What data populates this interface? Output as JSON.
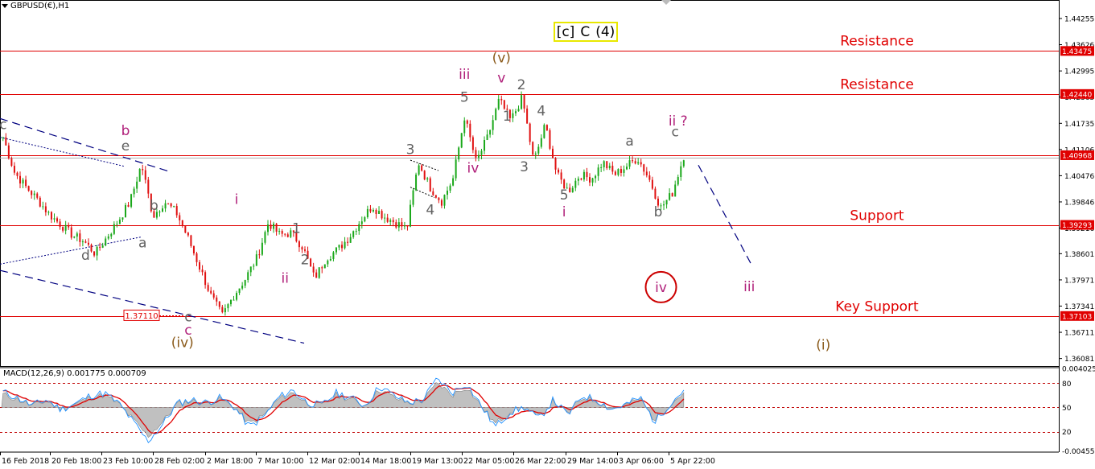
{
  "window": {
    "symbol_title": "GBPUSD(€),H1"
  },
  "indicator": {
    "label": "MACD(12,26,9) 0.001775 0.000709"
  },
  "banner": [
    {
      "text": "[c]",
      "color": "#1a8f3a"
    },
    {
      "text": "C",
      "color": "#e00000"
    },
    {
      "text": "(4)",
      "color": "#0000cc"
    }
  ],
  "price_axis": {
    "ticks": [
      "1.44255",
      "1.43626",
      "1.42995",
      "1.42365",
      "1.41735",
      "1.41106",
      "1.40476",
      "1.39846",
      "1.39216",
      "1.38601",
      "1.37971",
      "1.37341",
      "1.36711",
      "1.36081"
    ],
    "tick_values": [
      1.44255,
      1.43626,
      1.42995,
      1.42365,
      1.41735,
      1.41106,
      1.40476,
      1.39846,
      1.39216,
      1.38601,
      1.37971,
      1.37341,
      1.36711,
      1.36081
    ],
    "range": [
      1.359,
      1.447
    ],
    "tags": [
      {
        "text": "1.43475",
        "value": 1.43475
      },
      {
        "text": "1.42440",
        "value": 1.4244
      },
      {
        "text": "1.40968",
        "value": 1.40968
      },
      {
        "text": "1.39293",
        "value": 1.39293
      },
      {
        "text": "1.37103",
        "value": 1.37103
      }
    ],
    "last_price": 1.409
  },
  "levels": [
    {
      "label": "Resistance",
      "value": 1.43475
    },
    {
      "label": "Resistance",
      "value": 1.4244
    },
    {
      "label": "",
      "value": 1.40968
    },
    {
      "label": "Support",
      "value": 1.39293
    },
    {
      "label": "Key Support",
      "value": 1.37103
    }
  ],
  "low_tag": "1.37110",
  "macd_axis": {
    "ticks": [
      "0.004025",
      "80",
      "50",
      "20",
      "-0.004558"
    ],
    "tick_values": [
      0.004025,
      0.0025,
      0.0,
      -0.0025,
      -0.004558
    ]
  },
  "time_axis": [
    "16 Feb 2018",
    "20 Feb 18:00",
    "23 Feb 10:00",
    "28 Feb 02:00",
    "2 Mar 18:00",
    "7 Mar 10:00",
    "12 Mar 02:00",
    "14 Mar 18:00",
    "19 Mar 13:00",
    "22 Mar 05:00",
    "26 Mar 22:00",
    "29 Mar 14:00",
    "3 Apr 06:00",
    "5 Apr 22:00"
  ],
  "wave_labels": [
    {
      "text": "c",
      "color": "#606060",
      "price": 1.416,
      "bar": 0
    },
    {
      "text": "b",
      "color": "#b0207a",
      "price": 1.4145,
      "bar": 43
    },
    {
      "text": "e",
      "color": "#606060",
      "price": 1.4108,
      "bar": 43
    },
    {
      "text": "b",
      "color": "#606060",
      "price": 1.3965,
      "bar": 53
    },
    {
      "text": "a",
      "color": "#606060",
      "price": 1.3875,
      "bar": 49
    },
    {
      "text": "d",
      "color": "#606060",
      "price": 1.3845,
      "bar": 29
    },
    {
      "text": "c",
      "color": "#606060",
      "price": 1.3697,
      "bar": 65
    },
    {
      "text": "c",
      "color": "#b0207a",
      "price": 1.3665,
      "bar": 65
    },
    {
      "text": "(iv)",
      "color": "#8a5a1a",
      "price": 1.3635,
      "bar": 63
    },
    {
      "text": "i",
      "color": "#b0207a",
      "price": 1.398,
      "bar": 82
    },
    {
      "text": "ii",
      "color": "#b0207a",
      "price": 1.379,
      "bar": 99
    },
    {
      "text": "1",
      "color": "#606060",
      "price": 1.391,
      "bar": 103
    },
    {
      "text": "2",
      "color": "#606060",
      "price": 1.3835,
      "bar": 106
    },
    {
      "text": "3",
      "color": "#606060",
      "price": 1.41,
      "bar": 143
    },
    {
      "text": "4",
      "color": "#606060",
      "price": 1.3955,
      "bar": 150
    },
    {
      "text": "iii",
      "color": "#b0207a",
      "price": 1.428,
      "bar": 162
    },
    {
      "text": "5",
      "color": "#606060",
      "price": 1.4225,
      "bar": 162
    },
    {
      "text": "iv",
      "color": "#b0207a",
      "price": 1.4055,
      "bar": 165
    },
    {
      "text": "(v)",
      "color": "#8a5a1a",
      "price": 1.432,
      "bar": 175
    },
    {
      "text": "v",
      "color": "#b0207a",
      "price": 1.4272,
      "bar": 175
    },
    {
      "text": "1",
      "color": "#606060",
      "price": 1.418,
      "bar": 177
    },
    {
      "text": "2",
      "color": "#606060",
      "price": 1.4255,
      "bar": 182
    },
    {
      "text": "3",
      "color": "#606060",
      "price": 1.4058,
      "bar": 183
    },
    {
      "text": "4",
      "color": "#606060",
      "price": 1.4192,
      "bar": 189
    },
    {
      "text": "5",
      "color": "#606060",
      "price": 1.399,
      "bar": 197
    },
    {
      "text": "i",
      "color": "#b0207a",
      "price": 1.395,
      "bar": 197
    },
    {
      "text": "a",
      "color": "#606060",
      "price": 1.412,
      "bar": 220
    },
    {
      "text": "c",
      "color": "#606060",
      "price": 1.4142,
      "bar": 236
    },
    {
      "text": "b",
      "color": "#606060",
      "price": 1.395,
      "bar": 230
    },
    {
      "text": "ii ?",
      "color": "#b0207a",
      "price": 1.4168,
      "bar": 237
    },
    {
      "text": "iii",
      "color": "#b0207a",
      "price": 1.377,
      "bar": 262
    },
    {
      "text": "(i)",
      "color": "#8a5a1a",
      "price": 1.363,
      "bar": 288
    }
  ],
  "circle_label": {
    "text": "iv",
    "color": "#b0207a",
    "ring_color": "#cc0000",
    "price": 1.377,
    "bar": 231
  },
  "chart_data": {
    "type": "candlestick",
    "instrument": "GBPUSD",
    "timeframe": "H1",
    "x": [
      "16 Feb 2018",
      "20 Feb 18:00",
      "23 Feb 10:00",
      "28 Feb 02:00",
      "2 Mar 18:00",
      "7 Mar 10:00",
      "12 Mar 02:00",
      "14 Mar 18:00",
      "19 Mar 13:00",
      "22 Mar 05:00",
      "26 Mar 22:00",
      "29 Mar 14:00",
      "3 Apr 06:00",
      "5 Apr 22:00"
    ],
    "price_path": [
      1.414,
      1.4055,
      1.402,
      1.399,
      1.3955,
      1.393,
      1.3905,
      1.389,
      1.386,
      1.39,
      1.394,
      1.3985,
      1.4075,
      1.395,
      1.3985,
      1.396,
      1.39,
      1.383,
      1.376,
      1.3711,
      1.376,
      1.38,
      1.385,
      1.3935,
      1.3905,
      1.391,
      1.3875,
      1.38,
      1.385,
      1.387,
      1.39,
      1.394,
      1.3975,
      1.395,
      1.3935,
      1.392,
      1.408,
      1.402,
      1.3985,
      1.404,
      1.419,
      1.408,
      1.414,
      1.423,
      1.418,
      1.4235,
      1.408,
      1.417,
      1.405,
      1.401,
      1.405,
      1.404,
      1.408,
      1.405,
      1.407,
      1.409,
      1.404,
      1.397,
      1.4005,
      1.4095
    ],
    "macd_path": [
      0.0016,
      0.001,
      0.0002,
      0.0008,
      -0.0002,
      0.0004,
      0.0012,
      0.0015,
      0.0004,
      -0.0015,
      -0.0035,
      -0.0018,
      0.0004,
      0.0008,
      0.0005,
      0.001,
      0.0,
      -0.002,
      -0.001,
      0.001,
      0.0018,
      0.0005,
      0.0002,
      0.0015,
      0.001,
      0.0002,
      0.0022,
      0.0012,
      0.0005,
      0.0008,
      0.003,
      0.0015,
      0.0025,
      0.0002,
      -0.002,
      -0.0005,
      0.0,
      -0.0012,
      0.0008,
      -0.0008,
      0.0012,
      0.0008,
      -0.0002,
      0.0003,
      0.001,
      -0.0015,
      0.0003,
      0.0018
    ],
    "ylim": [
      1.359,
      1.447
    ],
    "grid": false
  },
  "colors": {
    "bull": "#1aa81a",
    "bear": "#e01010",
    "level": "#e00000",
    "trend_dash": "#000080",
    "macd_hist": "#c0c0c0",
    "macd_signal": "#e00000",
    "macd_line": "#1e90ff",
    "axis": "#000000"
  }
}
